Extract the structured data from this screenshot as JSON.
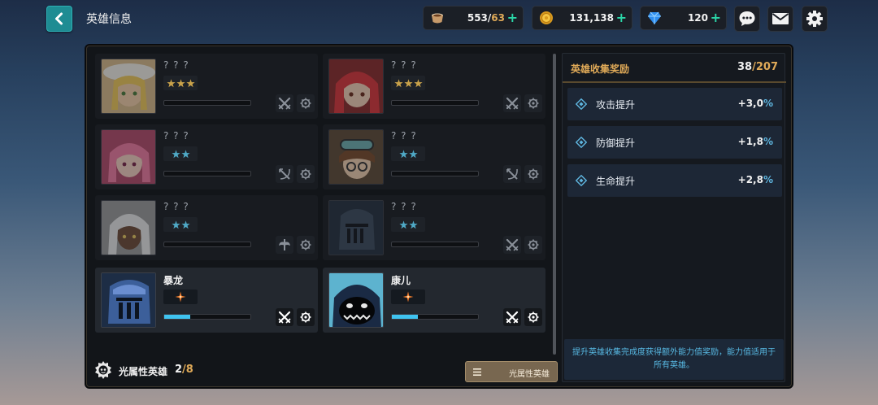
{
  "header": {
    "title": "英雄信息"
  },
  "resources": [
    {
      "icon": "coffee-stamina-icon",
      "current": "553",
      "max": "63"
    },
    {
      "icon": "gold-coin-icon",
      "value": "131,138"
    },
    {
      "icon": "blue-gem-icon",
      "value": "120"
    }
  ],
  "colors": {
    "accent_teal": "#1e8c93",
    "star_gold": "#c9a24a",
    "star_teal": "#4fa9c6",
    "progress_blue": "#3fc3f0",
    "gold_text": "#e0aa58",
    "plus_green": "#2bd6a8"
  },
  "heroes": [
    {
      "name": "? ? ?",
      "owned": false,
      "stars": 3,
      "star_color": "gold",
      "element_icon": "crossed-swords-icon",
      "progress": 0,
      "portrait": "blonde-girl-white-hat"
    },
    {
      "name": "? ? ?",
      "owned": false,
      "stars": 3,
      "star_color": "gold",
      "element_icon": "crossed-swords-icon",
      "progress": 0,
      "portrait": "red-haired-girl"
    },
    {
      "name": "? ? ?",
      "owned": false,
      "stars": 2,
      "star_color": "teal",
      "element_icon": "crossed-bow-icon",
      "progress": 0,
      "portrait": "pink-haired-girl"
    },
    {
      "name": "? ? ?",
      "owned": false,
      "stars": 2,
      "star_color": "teal",
      "element_icon": "crossed-bow-icon",
      "progress": 0,
      "portrait": "goggles-boy"
    },
    {
      "name": "? ? ?",
      "owned": false,
      "stars": 2,
      "star_color": "teal",
      "element_icon": "staff-wings-icon",
      "progress": 0,
      "portrait": "white-haired-girl"
    },
    {
      "name": "? ? ?",
      "owned": false,
      "stars": 2,
      "star_color": "teal",
      "element_icon": "crossed-swords-icon",
      "progress": 0,
      "portrait": "dark-knight"
    },
    {
      "name": "暴龙",
      "owned": true,
      "stars": 1,
      "star_color": "orange",
      "element_icon": "crossed-swords-icon",
      "progress": 0.3,
      "portrait": "blue-knight"
    },
    {
      "name": "康儿",
      "owned": true,
      "stars": 1,
      "star_color": "orange",
      "element_icon": "crossed-swords-icon",
      "progress": 0.3,
      "portrait": "hooded-shadow"
    }
  ],
  "footer": {
    "label": "光属性英雄",
    "owned": "2",
    "total": "8",
    "sort_label": "光属性英雄"
  },
  "collection": {
    "title": "英雄收集奖励",
    "current": "38",
    "total": "207",
    "stats": [
      {
        "label": "攻击提升",
        "value": "+3,0",
        "unit": "%"
      },
      {
        "label": "防御提升",
        "value": "+1,8",
        "unit": "%"
      },
      {
        "label": "生命提升",
        "value": "+2,8",
        "unit": "%"
      }
    ],
    "description": "提升英雄收集完成度获得额外能力值奖励，能力值适用于所有英雄。"
  }
}
